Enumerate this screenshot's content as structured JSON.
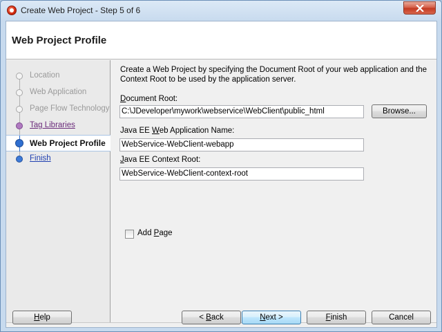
{
  "window": {
    "title": "Create Web Project - Step 5 of 6",
    "close_symbol": "close-icon"
  },
  "header": {
    "title": "Web Project Profile"
  },
  "steps": [
    {
      "label": "Location",
      "state": "done"
    },
    {
      "label": "Web Application",
      "state": "done"
    },
    {
      "label": "Page Flow Technology",
      "state": "done"
    },
    {
      "label": "Tag Libraries",
      "state": "visited"
    },
    {
      "label": "Web Project Profile",
      "state": "current"
    },
    {
      "label": "Finish",
      "state": "link"
    }
  ],
  "main": {
    "description": "Create a Web Project by specifying the Document Root of your web application and the Context Root to be used by the application server.",
    "document_root": {
      "label_pre": "",
      "label_mnemonic": "D",
      "label_post": "ocument Root:",
      "value": "C:\\JDeveloper\\mywork\\webservice\\WebClient\\public_html"
    },
    "browse_label": "Browse...",
    "app_name": {
      "label_pre": "Java EE ",
      "label_mnemonic": "W",
      "label_post": "eb Application Name:",
      "value": "WebService-WebClient-webapp"
    },
    "context_root": {
      "label_pre": "",
      "label_mnemonic": "J",
      "label_post": "ava EE Context Root:",
      "value": "WebService-WebClient-context-root"
    },
    "add_page": {
      "label_pre": "Add ",
      "label_mnemonic": "P",
      "label_post": "age",
      "checked": false
    }
  },
  "footer": {
    "help": {
      "mnemonic": "H",
      "post": "elp"
    },
    "back": {
      "pre": "< ",
      "mnemonic": "B",
      "post": "ack"
    },
    "next": {
      "mnemonic": "N",
      "post": "ext >"
    },
    "finish": {
      "mnemonic": "F",
      "post": "inish"
    },
    "cancel": "Cancel"
  }
}
